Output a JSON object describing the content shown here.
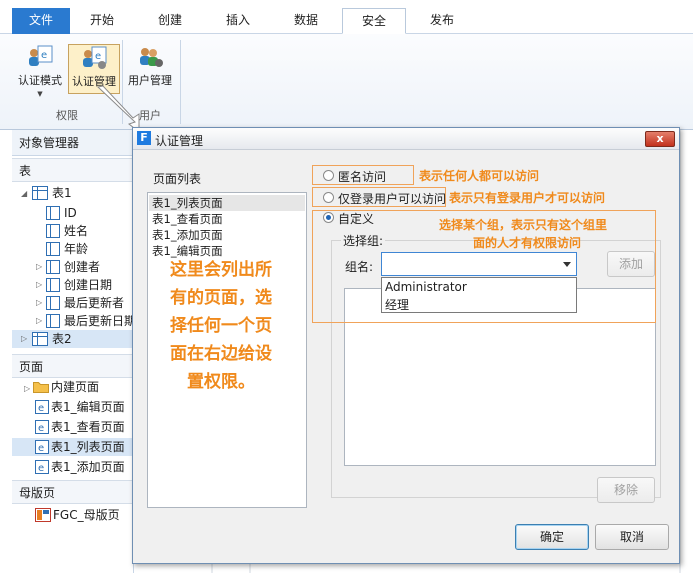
{
  "ribbon": {
    "tabs": [
      "文件",
      "开始",
      "创建",
      "插入",
      "数据",
      "安全",
      "发布"
    ],
    "active_tab": "安全",
    "buttons": {
      "auth_mode": "认证模式",
      "auth_manage": "认证管理",
      "user_manage": "用户管理"
    },
    "groups": [
      "权限",
      "用户"
    ]
  },
  "object_manager": {
    "title": "对象管理器",
    "sections": {
      "tables": "表",
      "pages": "页面",
      "masters": "母版页"
    },
    "table1": {
      "name": "表1",
      "fields": [
        "ID",
        "姓名",
        "年龄",
        "创建者",
        "创建日期",
        "最后更新者",
        "最后更新日期"
      ]
    },
    "table2": "表2",
    "pages": [
      "内建页面",
      "表1_编辑页面",
      "表1_查看页面",
      "表1_列表页面",
      "表1_添加页面"
    ],
    "selected_page": "表1_列表页面",
    "masters": [
      "FGC_母版页"
    ]
  },
  "dialog": {
    "title": "认证管理",
    "logo_letter": "F",
    "close_label": "x",
    "page_list_label": "页面列表",
    "page_list": [
      "表1_列表页面",
      "表1_查看页面",
      "表1_添加页面",
      "表1_编辑页面"
    ],
    "selected_page": "表1_列表页面",
    "options": {
      "anonymous": "匿名访问",
      "logged_in": "仅登录用户可以访问",
      "custom": "自定义"
    },
    "selected_option": "自定义",
    "select_group_label": "选择组:",
    "group_label": "组名:",
    "group_options": [
      "Administrator",
      "经理"
    ],
    "add_label": "添加",
    "remove_label": "移除",
    "ok_label": "确定",
    "cancel_label": "取消"
  },
  "annotations": {
    "anonymous_note": "表示任何人都可以访问",
    "logged_in_note": "表示只有登录用户才可以访问",
    "custom_note_line1": "选择某个组，表示只有这个组里",
    "custom_note_line2": "面的人才有权限访问",
    "page_note_lines": [
      "这里会列出所",
      "有的页面，选",
      "择任何一个页",
      "面在右边给设",
      "置权限。"
    ]
  },
  "colors": {
    "file_tab": "#2a7ad0",
    "annotation": "#f08a1c",
    "close_button": "#c2311d",
    "dropdown_border": "#3f86d4"
  }
}
